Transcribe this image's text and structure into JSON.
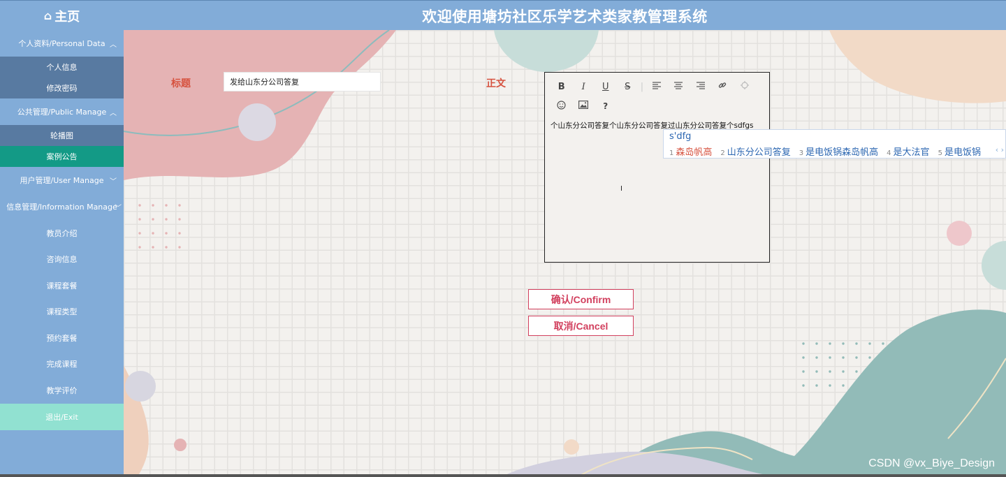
{
  "header": {
    "home_icon": "home-icon",
    "home_label": "主页",
    "site_title": "欢迎使用塘坊社区乐学艺术类家教管理系统"
  },
  "sidebar": {
    "groups": [
      {
        "label": "个人资料/Personal Data",
        "expanded": true,
        "items": [
          {
            "label": "个人信息"
          },
          {
            "label": "修改密码"
          }
        ]
      },
      {
        "label": "公共管理/Public Manage",
        "expanded": true,
        "items": [
          {
            "label": "轮播图"
          },
          {
            "label": "案例公告",
            "active": true
          }
        ]
      },
      {
        "label": "用户管理/User Manage",
        "expanded": false
      },
      {
        "label": "信息管理/Information Manage",
        "expanded": false
      }
    ],
    "plain_items": [
      {
        "label": "教员介绍"
      },
      {
        "label": "咨询信息"
      },
      {
        "label": "课程套餐"
      },
      {
        "label": "课程类型"
      },
      {
        "label": "预约套餐"
      },
      {
        "label": "完成课程"
      },
      {
        "label": "教学评价"
      }
    ],
    "exit_label": "退出/Exit"
  },
  "form": {
    "title_label": "标题",
    "title_value": "发给山东分公司答复",
    "body_label": "正文",
    "editor_content": "个山东分公司答复个山东分公司答复过山东分公司答复个sdfgs",
    "toolbar": {
      "bold": "B",
      "italic": "I",
      "underline": "U",
      "strike": "S",
      "help": "?"
    },
    "confirm_label": "确认/Confirm",
    "cancel_label": "取消/Cancel"
  },
  "ime": {
    "composition": "s'dfg",
    "candidates": [
      {
        "num": "1",
        "text": "森岛帆高"
      },
      {
        "num": "2",
        "text": "山东分公司答复"
      },
      {
        "num": "3",
        "text": "是电饭锅森岛帆高"
      },
      {
        "num": "4",
        "text": "是大法官"
      },
      {
        "num": "5",
        "text": "是电饭锅"
      }
    ]
  },
  "watermark": "CSDN @vx_Biye_Design",
  "colors": {
    "header_bg": "#82acd8",
    "submenu_bg": "#587aa1",
    "active_item_bg": "#139a86",
    "exit_bg": "#91e1d1",
    "label_color": "#d6523f",
    "button_border": "#d2405e"
  }
}
